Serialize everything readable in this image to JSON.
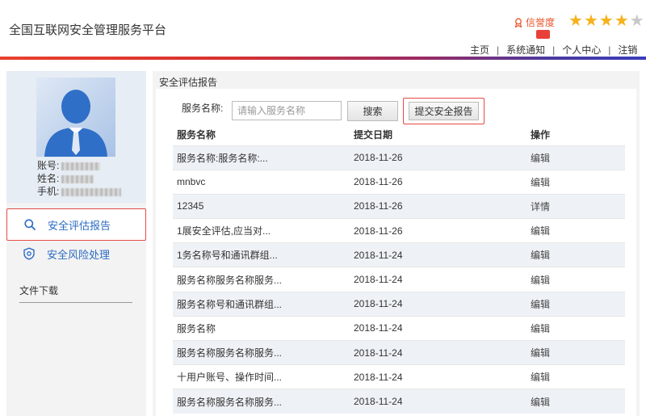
{
  "header": {
    "title": "全国互联网安全管理服务平台",
    "credit_label": "信誉度",
    "stars": [
      true,
      true,
      true,
      true,
      false
    ],
    "nav": [
      "主页",
      "系统通知",
      "个人中心",
      "注销"
    ]
  },
  "sidebar": {
    "profile": {
      "account_label": "账号:",
      "name_label": "姓名:",
      "phone_label": "手机:"
    },
    "menu": [
      {
        "label": "安全评估报告",
        "icon": "search-icon",
        "active": true
      },
      {
        "label": "安全风险处理",
        "icon": "shield-icon",
        "active": false
      }
    ],
    "downloads_label": "文件下载"
  },
  "main": {
    "panel_title": "安全评估报告",
    "search": {
      "label": "服务名称:",
      "placeholder": "请输入服务名称",
      "search_button": "搜索",
      "submit_button": "提交安全报告"
    },
    "table": {
      "headers": [
        "服务名称",
        "提交日期",
        "操作"
      ],
      "rows": [
        {
          "name": "服务名称:服务名称:...",
          "date": "2018-11-26",
          "action": "编辑"
        },
        {
          "name": "mnbvc",
          "date": "2018-11-26",
          "action": "编辑"
        },
        {
          "name": "12345",
          "date": "2018-11-26",
          "action": "详情"
        },
        {
          "name": "1展安全评估,应当对...",
          "date": "2018-11-26",
          "action": "编辑"
        },
        {
          "name": "1务名称号和通讯群组...",
          "date": "2018-11-24",
          "action": "编辑"
        },
        {
          "name": "服务名称服务名称服务...",
          "date": "2018-11-24",
          "action": "编辑"
        },
        {
          "name": "服务名称号和通讯群组...",
          "date": "2018-11-24",
          "action": "编辑"
        },
        {
          "name": "服务名称",
          "date": "2018-11-24",
          "action": "编辑"
        },
        {
          "name": "服务名称服务名称服务...",
          "date": "2018-11-24",
          "action": "编辑"
        },
        {
          "name": "十用户账号、操作时间...",
          "date": "2018-11-24",
          "action": "编辑"
        },
        {
          "name": "服务名称服务名称服务...",
          "date": "2018-11-24",
          "action": "编辑"
        }
      ]
    }
  },
  "colors": {
    "accent_red": "#e34b45",
    "link_blue": "#2b6cc4",
    "star_gold": "#f5b21b",
    "credit_orange": "#e8532a"
  }
}
